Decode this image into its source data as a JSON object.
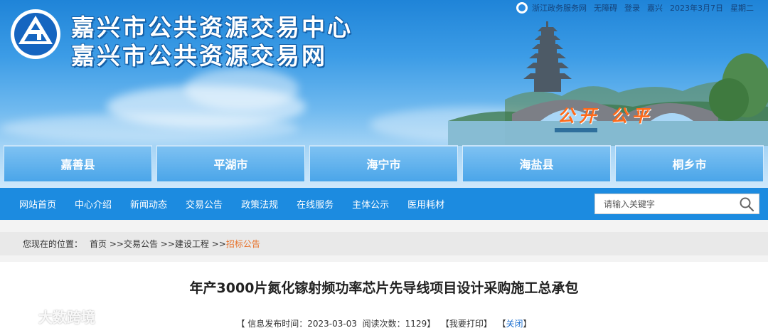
{
  "header": {
    "title_line1": "嘉兴市公共资源交易中心",
    "title_line2": "嘉兴市公共资源交易网",
    "slogan": "公开  公平",
    "topbar": {
      "portal": "浙江政务服务网",
      "accessible": "无障碍",
      "login": "登录",
      "city": "嘉兴",
      "date": "2023年3月7日",
      "weekday": "星期二"
    }
  },
  "counties": [
    "嘉善县",
    "平湖市",
    "海宁市",
    "海盐县",
    "桐乡市"
  ],
  "nav": {
    "items": [
      "网站首页",
      "中心介绍",
      "新闻动态",
      "交易公告",
      "政策法规",
      "在线服务",
      "主体公示",
      "医用耗材"
    ],
    "search_placeholder": "请输入关键字"
  },
  "breadcrumb": {
    "label": "您现在的位置：",
    "items": [
      "首页 >>",
      "交易公告 >>",
      "建设工程 >>"
    ],
    "current": "招标公告"
  },
  "article": {
    "title": "年产3000片氮化镓射频功率芯片先导线项目设计采购施工总承包",
    "publish_label": "【 信息发布时间：",
    "publish_date": "2023-03-03",
    "views_label": "阅读次数：",
    "views": "1129",
    "print": "【我要打印】",
    "close": "关闭"
  },
  "watermark": "大数跨境",
  "colors": {
    "nav_bg": "#1c8be0",
    "county_bg": "#4aa5e9",
    "slogan": "#ff6a1a",
    "breadcrumb_current": "#e7722b"
  }
}
